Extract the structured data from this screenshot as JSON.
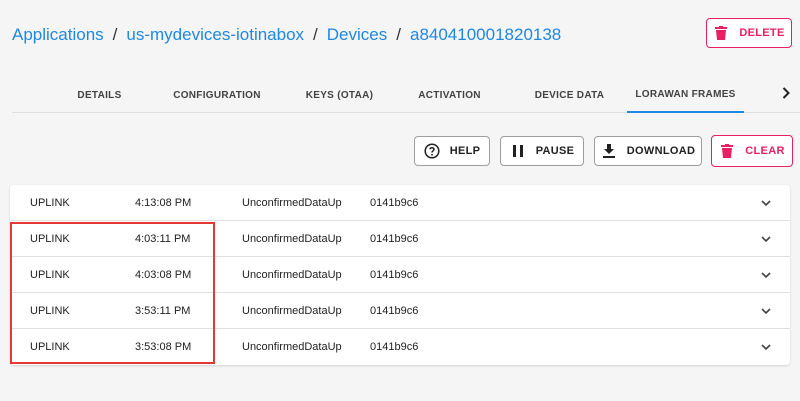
{
  "breadcrumb": {
    "items": [
      "Applications",
      "us-mydevices-iotinabox",
      "Devices",
      "a840410001820138"
    ],
    "separator": "/"
  },
  "header": {
    "delete_label": "DELETE"
  },
  "tabs": [
    {
      "label": "DETAILS"
    },
    {
      "label": "CONFIGURATION"
    },
    {
      "label": "KEYS (OTAA)"
    },
    {
      "label": "ACTIVATION"
    },
    {
      "label": "DEVICE DATA"
    },
    {
      "label": "LORAWAN FRAMES",
      "active": true
    }
  ],
  "toolbar": {
    "help_label": "HELP",
    "pause_label": "PAUSE",
    "download_label": "DOWNLOAD",
    "clear_label": "CLEAR"
  },
  "frames": [
    {
      "direction": "UPLINK",
      "time": "4:13:08 PM",
      "type": "UnconfirmedDataUp",
      "address": "0141b9c6"
    },
    {
      "direction": "UPLINK",
      "time": "4:03:11 PM",
      "type": "UnconfirmedDataUp",
      "address": "0141b9c6"
    },
    {
      "direction": "UPLINK",
      "time": "4:03:08 PM",
      "type": "UnconfirmedDataUp",
      "address": "0141b9c6"
    },
    {
      "direction": "UPLINK",
      "time": "3:53:11 PM",
      "type": "UnconfirmedDataUp",
      "address": "0141b9c6"
    },
    {
      "direction": "UPLINK",
      "time": "3:53:08 PM",
      "type": "UnconfirmedDataUp",
      "address": "0141b9c6"
    }
  ],
  "colors": {
    "link": "#1e88e5",
    "danger": "#e91e63",
    "highlight": "#e53935"
  },
  "icons": {
    "delete": "trash-icon",
    "help": "help-circle-icon",
    "pause": "pause-icon",
    "download": "download-icon",
    "clear": "trash-icon",
    "expand": "chevron-down-icon",
    "tabs_next": "chevron-right-icon"
  }
}
